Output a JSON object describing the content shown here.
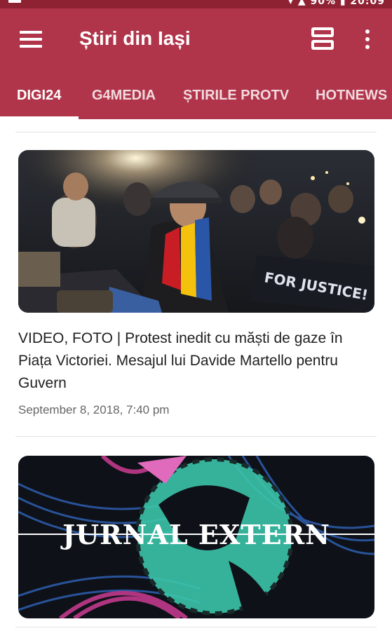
{
  "app": {
    "title": "Știri din Iași",
    "accent_color": "#b0354b",
    "status_bar_color": "#8e2232"
  },
  "status_bar": {
    "time_partial": "▾ ▲ 90% ▮ 20:09"
  },
  "toolbar": {
    "menu_icon": "hamburger-menu-icon",
    "view_icon": "view-agenda-icon",
    "more_icon": "more-vert-icon"
  },
  "tabs": [
    {
      "label": "DIGI24",
      "selected": true
    },
    {
      "label": "G4MEDIA",
      "selected": false
    },
    {
      "label": "ȘTIRILE PROTV",
      "selected": false
    },
    {
      "label": "HOTNEWS",
      "selected": false
    }
  ],
  "articles": [
    {
      "image": {
        "banner_text": "FOR JUSTICE!"
      },
      "headline": "VIDEO, FOTO | Protest inedit cu măști de gaze în Piața Victoriei. Mesajul lui Davide Martello pentru Guvern",
      "date": "September 8, 2018, 7:40 pm"
    },
    {
      "image": {
        "overlay_text": "JURNAL EXTERN"
      }
    }
  ]
}
